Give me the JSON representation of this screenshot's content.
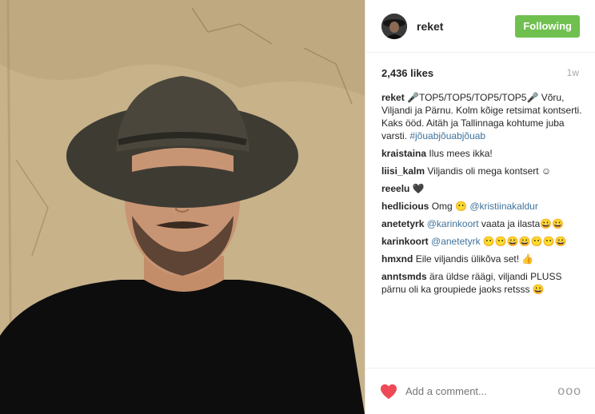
{
  "header": {
    "username": "reket",
    "follow_label": "Following"
  },
  "meta": {
    "likes": "2,436 likes",
    "time": "1w"
  },
  "comments": [
    {
      "user": "reket",
      "text": "🎤TOP5/TOP5/TOP5/TOP5🎤 Võru, Viljandi ja Pärnu. Kolm kõige retsimat kontserti. Kaks ööd. Aitäh ja Tallinnaga kohtume juba varsti. ",
      "tag": "#jõuabjõuabjõuab"
    },
    {
      "user": "kraistaina",
      "text": "Ilus mees ikka!"
    },
    {
      "user": "liisi_kalm",
      "text": "Viljandis oli mega kontsert ☺"
    },
    {
      "user": "reeelu",
      "text": "🖤"
    },
    {
      "user": "hedlicious",
      "text": "Omg 😶 ",
      "tag": "@kristiinakaldur"
    },
    {
      "user": "anetetyrk",
      "tag": "@karinkoort",
      "text": " vaata ja ilasta😀😀"
    },
    {
      "user": "karinkoort",
      "tag": "@anetetyrk",
      "text": " 😶😶😀😀😶😶😀"
    },
    {
      "user": "hmxnd",
      "text": "Eile viljandis ülikõva set! 👍"
    },
    {
      "user": "anntsmds",
      "text": "ära üldse räägi, viljandi PLUSS pärnu oli ka groupiede jaoks retsss 😀"
    }
  ],
  "footer": {
    "comment_placeholder": "Add a comment...",
    "more_label": "ooo"
  },
  "colors": {
    "follow_bg": "#70c050",
    "heart": "#ed4956",
    "tag": "#3f729b"
  }
}
